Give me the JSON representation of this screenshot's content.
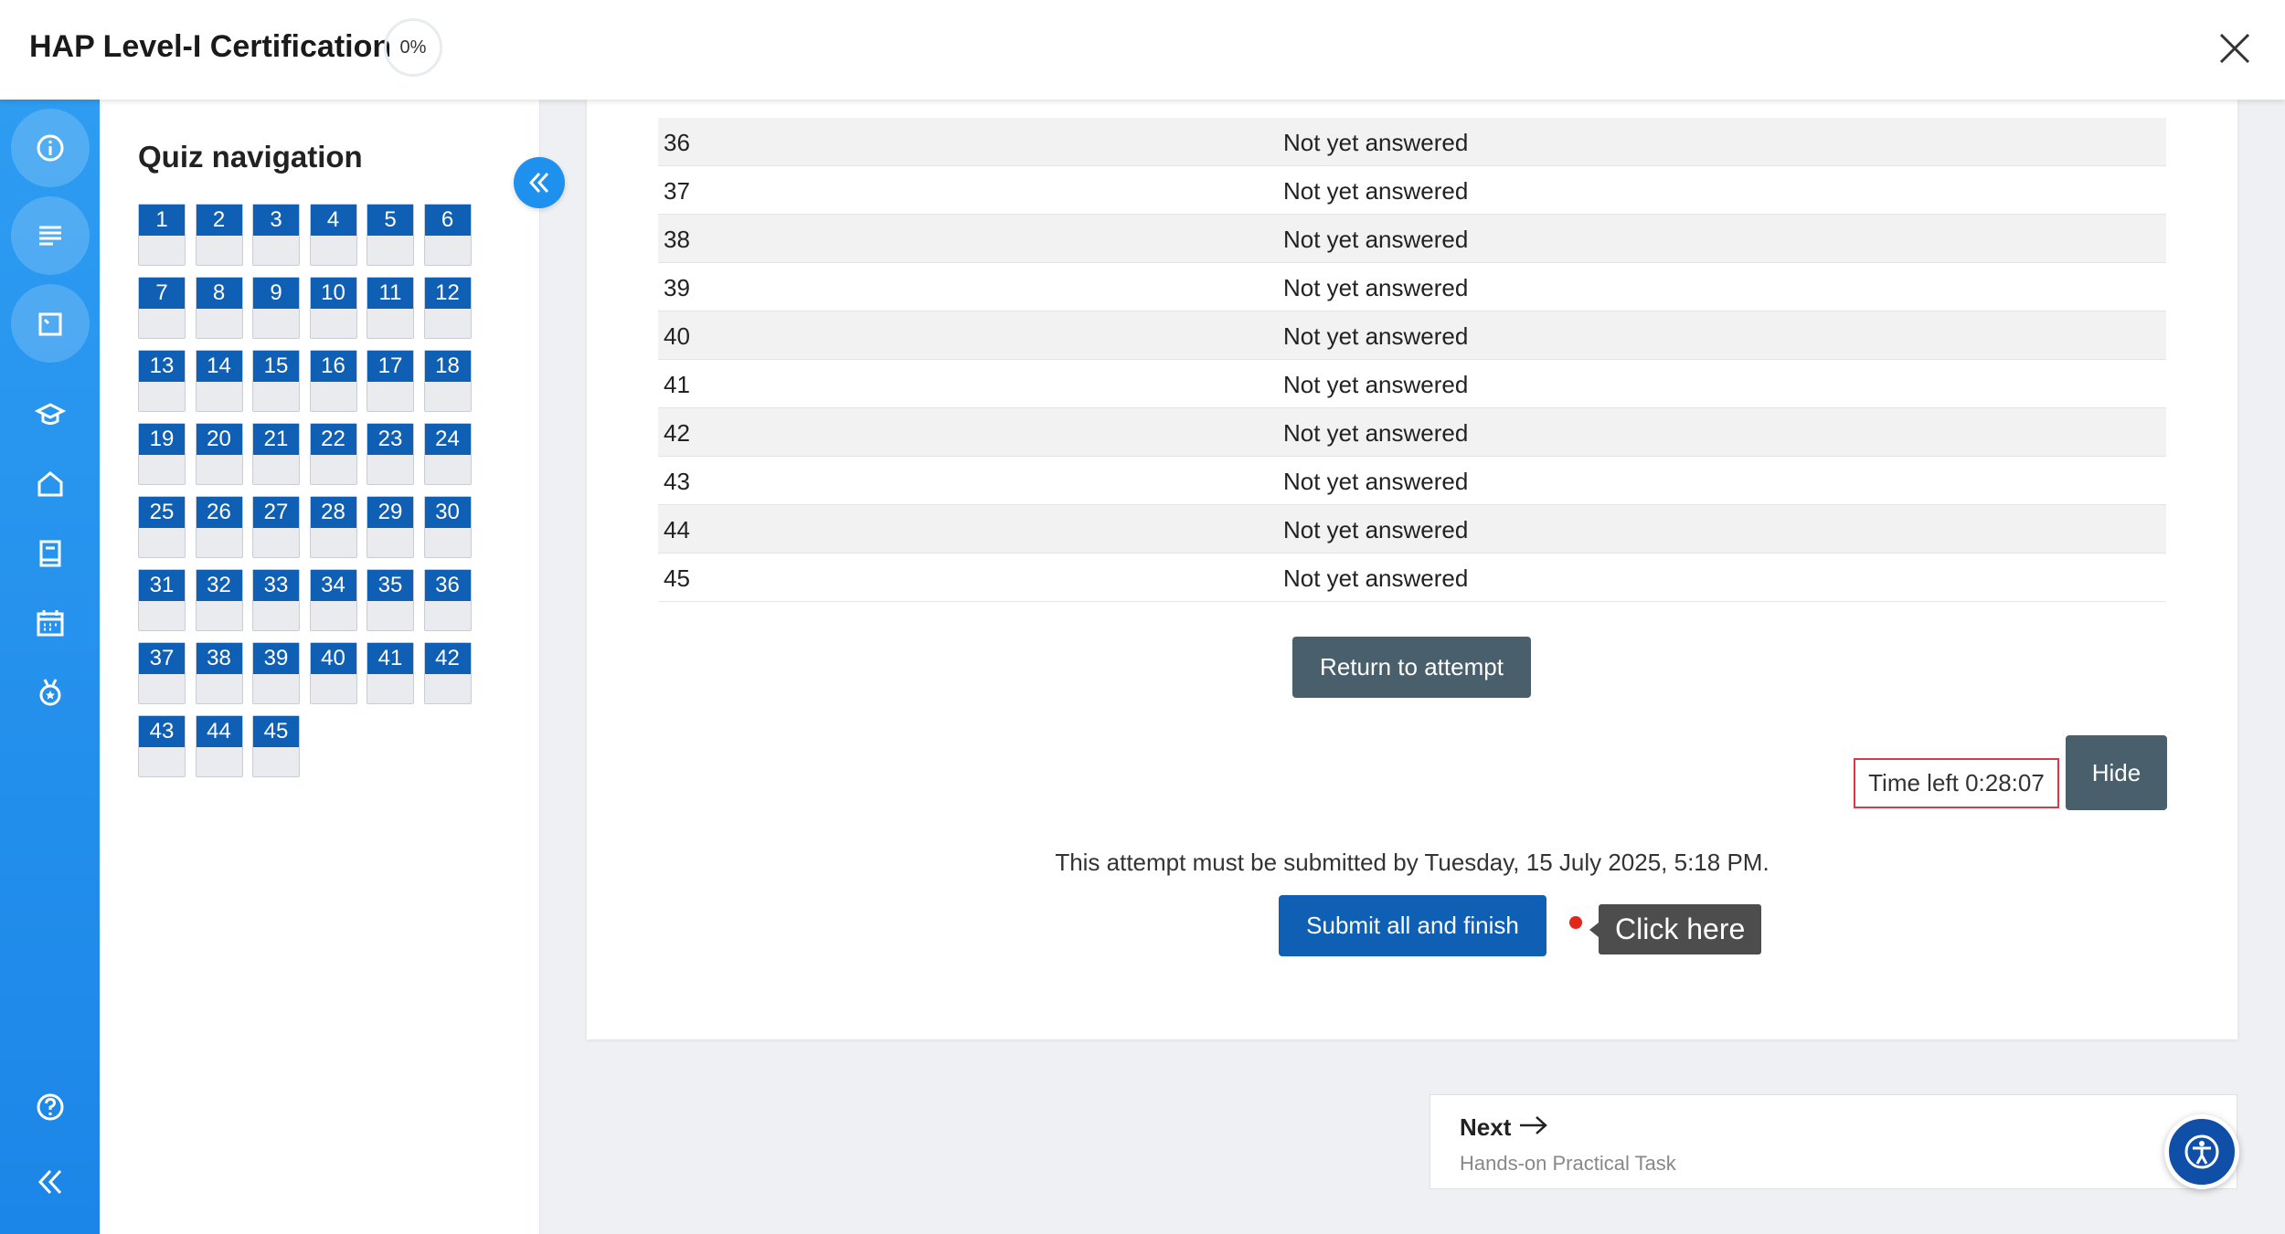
{
  "header": {
    "title": "HAP Level-I Certification",
    "progress": "0%"
  },
  "rail": {
    "items": [
      "info-icon",
      "contents-icon",
      "quiz-icon",
      "graduation-cap-icon",
      "home-icon",
      "book-icon",
      "calendar-icon",
      "badge-icon"
    ],
    "bottom": [
      "help-icon",
      "collapse-sidebar-icon"
    ]
  },
  "quiz_nav": {
    "title": "Quiz navigation",
    "questions": [
      "1",
      "2",
      "3",
      "4",
      "5",
      "6",
      "7",
      "8",
      "9",
      "10",
      "11",
      "12",
      "13",
      "14",
      "15",
      "16",
      "17",
      "18",
      "19",
      "20",
      "21",
      "22",
      "23",
      "24",
      "25",
      "26",
      "27",
      "28",
      "29",
      "30",
      "31",
      "32",
      "33",
      "34",
      "35",
      "36",
      "37",
      "38",
      "39",
      "40",
      "41",
      "42",
      "43",
      "44",
      "45"
    ]
  },
  "summary": {
    "rows": [
      {
        "q": "36",
        "status": "Not yet answered"
      },
      {
        "q": "37",
        "status": "Not yet answered"
      },
      {
        "q": "38",
        "status": "Not yet answered"
      },
      {
        "q": "39",
        "status": "Not yet answered"
      },
      {
        "q": "40",
        "status": "Not yet answered"
      },
      {
        "q": "41",
        "status": "Not yet answered"
      },
      {
        "q": "42",
        "status": "Not yet answered"
      },
      {
        "q": "43",
        "status": "Not yet answered"
      },
      {
        "q": "44",
        "status": "Not yet answered"
      },
      {
        "q": "45",
        "status": "Not yet answered"
      }
    ]
  },
  "actions": {
    "return_label": "Return to attempt",
    "timer": "Time left 0:28:07",
    "hide_label": "Hide",
    "deadline": "This attempt must be submitted by Tuesday, 15 July 2025, 5:18 PM.",
    "submit_label": "Submit all and finish",
    "hint": "Click here"
  },
  "next": {
    "label": "Next",
    "subtitle": "Hands-on Practical Task"
  },
  "colors": {
    "primary": "#0f5fb5",
    "rail": "#1e90ee",
    "dark_button": "#4a5f6c",
    "timer_border": "#d43a4a"
  }
}
